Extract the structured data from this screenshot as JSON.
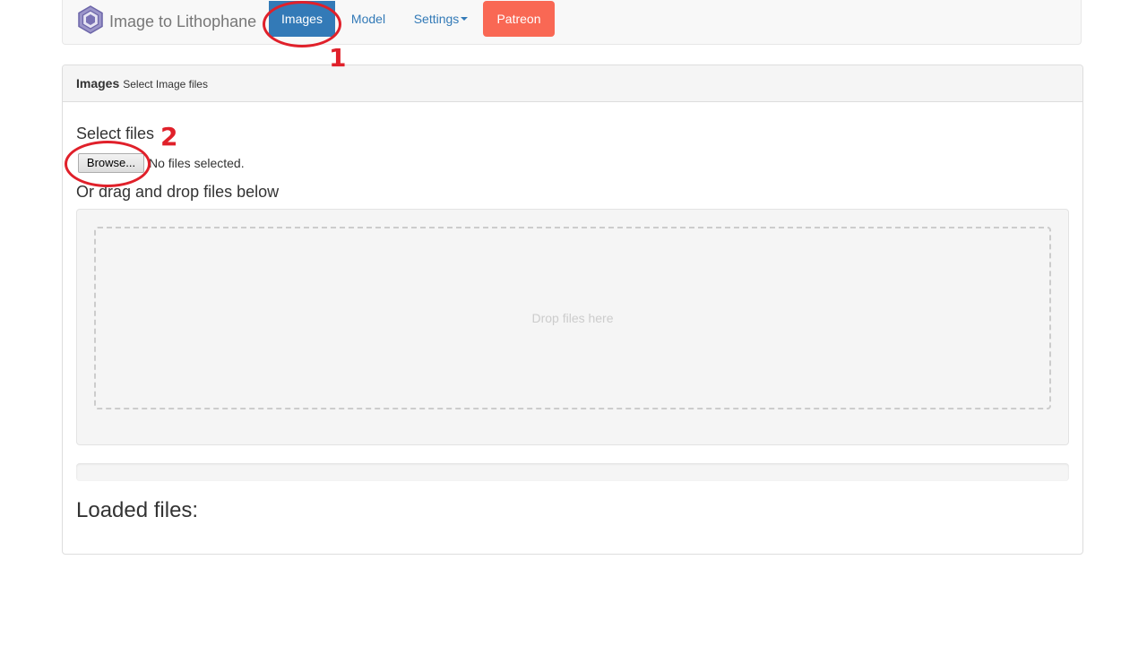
{
  "navbar": {
    "brand": "Image to Lithophane",
    "items": [
      {
        "label": "Images",
        "active": true
      },
      {
        "label": "Model",
        "active": false
      },
      {
        "label": "Settings",
        "active": false,
        "dropdown": true
      },
      {
        "label": "Patreon",
        "active": false
      }
    ]
  },
  "panel": {
    "heading_title": "Images",
    "heading_subtitle": "Select Image files",
    "select_label": "Select files",
    "browse_label": "Browse...",
    "file_status": "No files selected.",
    "drag_label": "Or drag and drop files below",
    "drop_placeholder": "Drop files here",
    "upload_progress_fraction": 0,
    "loaded_label": "Loaded files:"
  },
  "annotations": [
    {
      "number": "1",
      "target": "Images tab"
    },
    {
      "number": "2",
      "target": "Browse button"
    }
  ],
  "colors": {
    "primary": "#337ab7",
    "patreon": "#f96854",
    "annotation": "#e0202a"
  },
  "icons": {
    "brand": "lithophane-logo-icon",
    "settings_dropdown": "caret-down-icon"
  }
}
